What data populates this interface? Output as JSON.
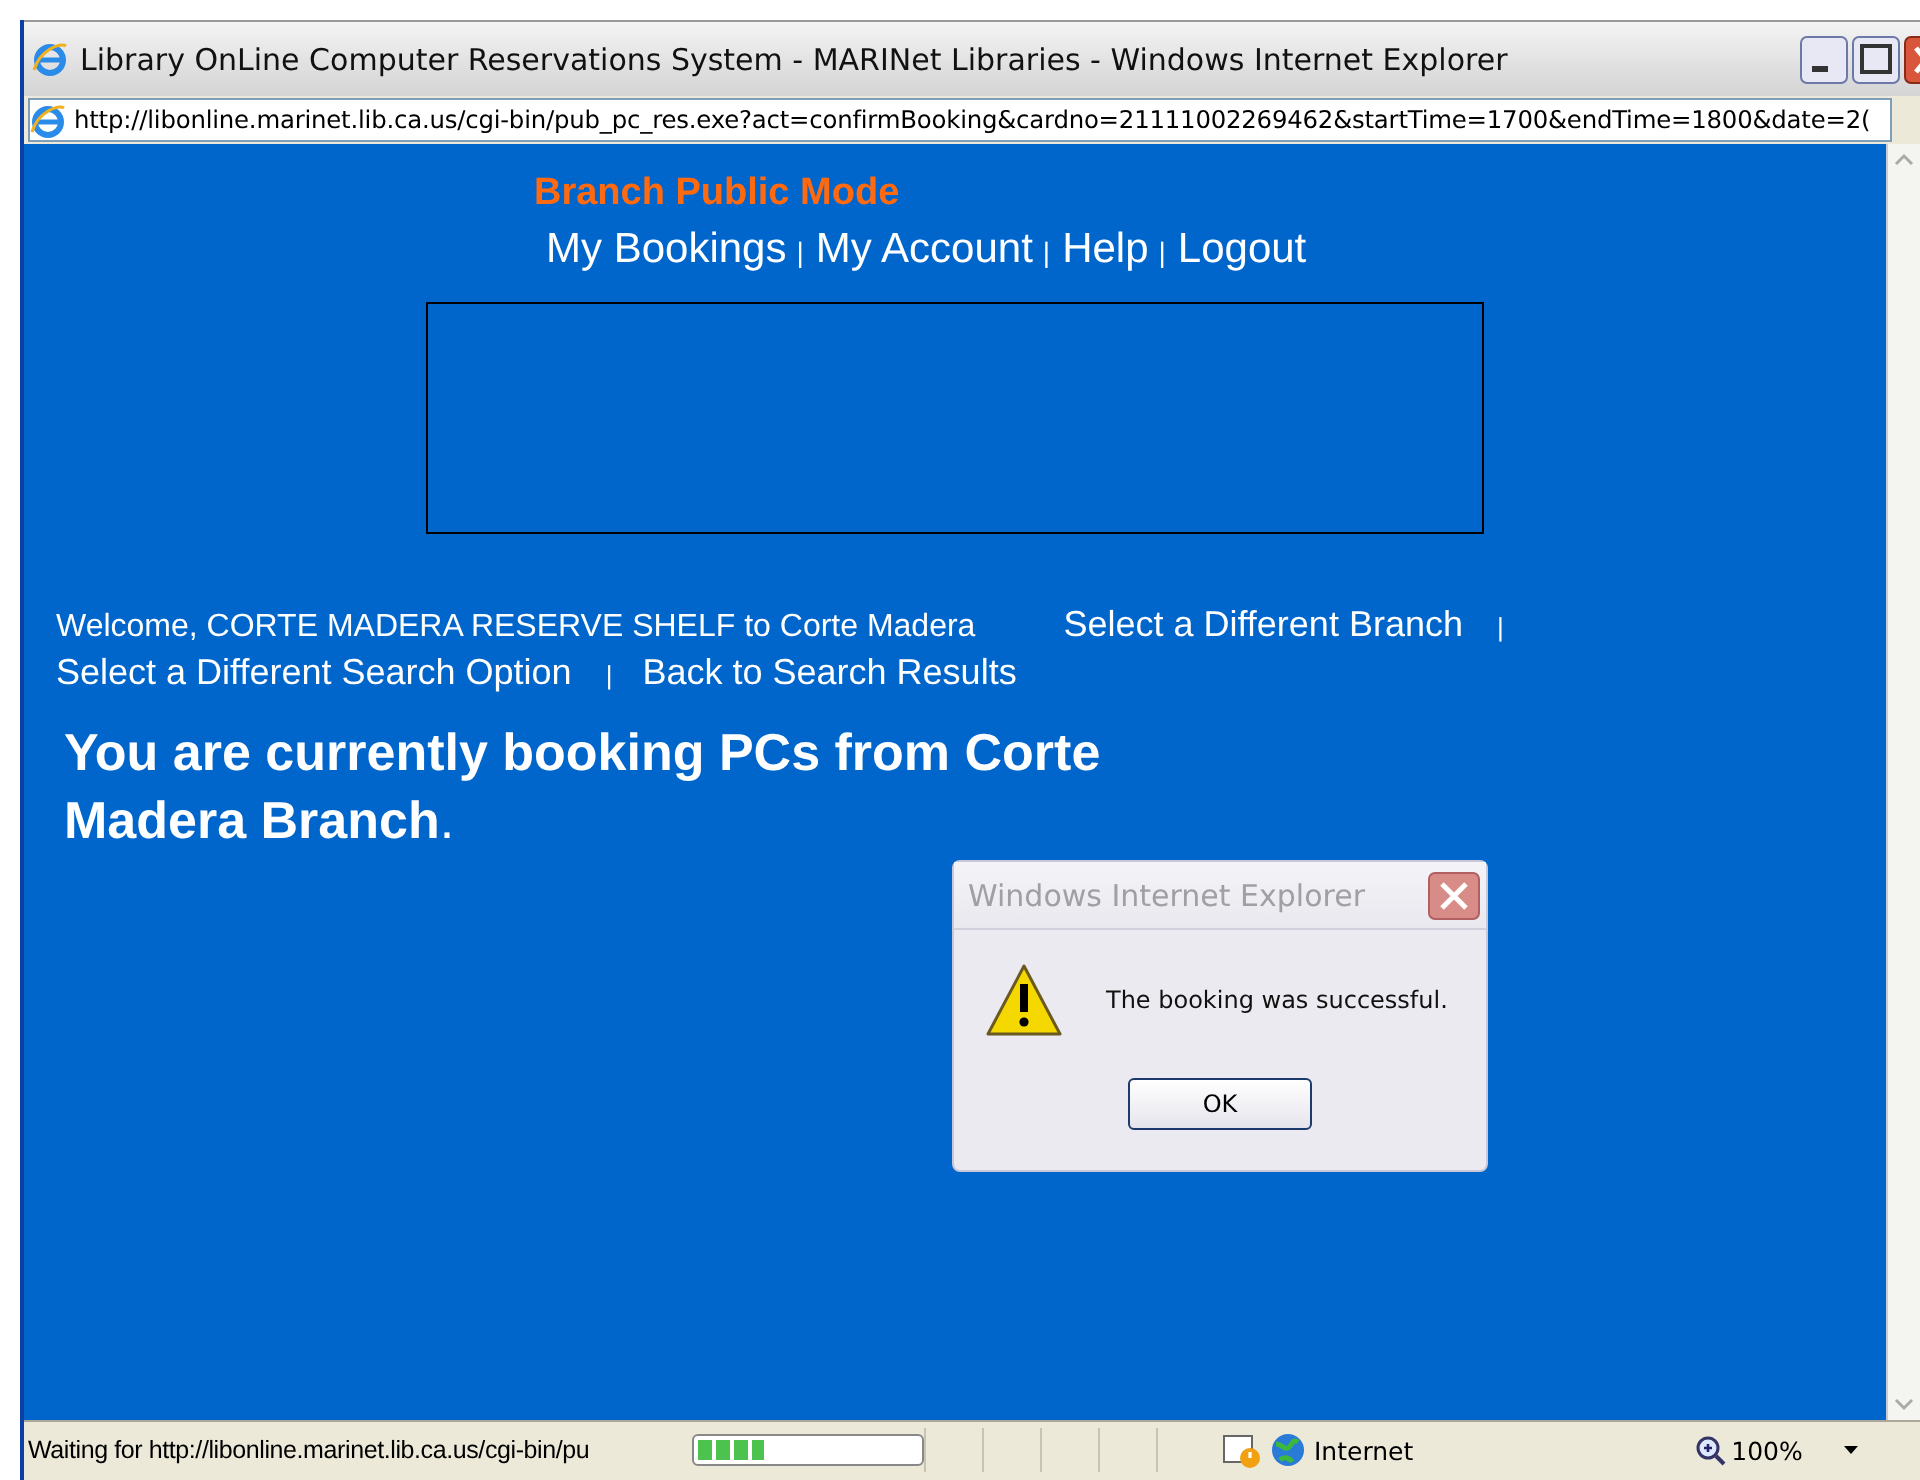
{
  "window": {
    "title": "Library OnLine Computer Reservations System - MARINet Libraries - Windows Internet Explorer"
  },
  "address_bar": {
    "url": "http://libonline.marinet.lib.ca.us/cgi-bin/pub_pc_res.exe?act=confirmBooking&cardno=21111002269462&startTime=1700&endTime=1800&date=2("
  },
  "page": {
    "mode_label": "Branch Public Mode",
    "nav": [
      {
        "label": "My Bookings",
        "separator": "|"
      },
      {
        "label": "My Account",
        "separator": "|"
      },
      {
        "label": "Help",
        "separator": "|"
      },
      {
        "label": "Logout"
      }
    ],
    "welcome": "Welcome, CORTE MADERA RESERVE SHELF to Corte Madera",
    "links": [
      {
        "label": "Select a Different Branch",
        "separator": "|"
      },
      {
        "label": "Select a Different Search Option",
        "separator": "|"
      },
      {
        "label": "Back to Search Results"
      }
    ],
    "heading": "**You are currently booking PCs from Corte Madera Branch**."
  },
  "dialog": {
    "title": "Windows Internet Explorer",
    "message": "The booking was successful.",
    "button": "OK"
  },
  "status_bar": {
    "text": "Waiting for http://libonline.marinet.lib.ca.us/cgi-bin/pu",
    "progress": {
      "level": 0.3
    },
    "zone": "Internet",
    "zoom": "100%"
  }
}
